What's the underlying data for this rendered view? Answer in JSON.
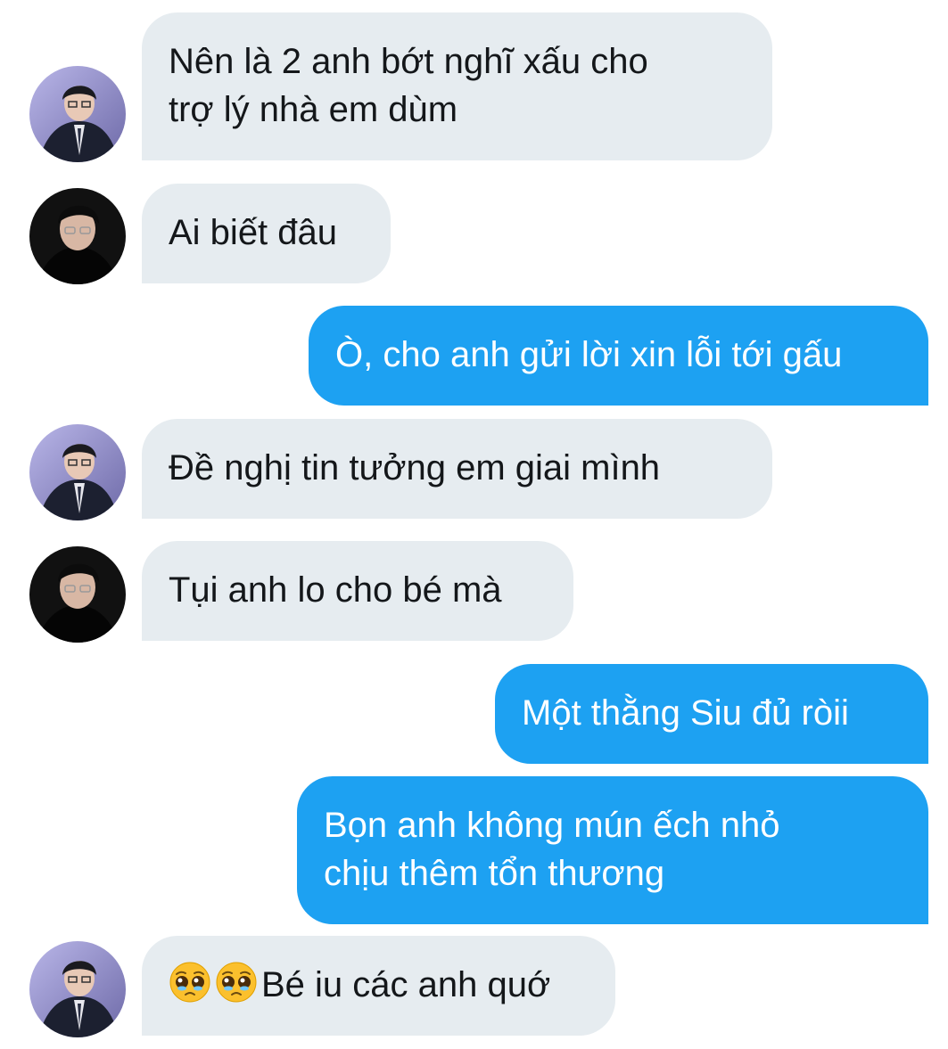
{
  "conversation": {
    "messages": [
      {
        "direction": "in",
        "avatar": "avatar-a",
        "lines": [
          "Nên là 2 anh bớt nghĩ xấu cho",
          "trợ lý nhà em dùm"
        ]
      },
      {
        "direction": "in",
        "avatar": "avatar-b",
        "lines": [
          "Ai biết đâu"
        ]
      },
      {
        "direction": "out",
        "lines": [
          "Ò, cho anh gửi lời xin lỗi tới gấu"
        ]
      },
      {
        "direction": "in",
        "avatar": "avatar-a",
        "lines": [
          "Đề nghị tin tưởng em giai mình"
        ]
      },
      {
        "direction": "in",
        "avatar": "avatar-b",
        "lines": [
          "Tụi anh lo cho bé mà"
        ]
      },
      {
        "direction": "out",
        "lines": [
          "Một thằng Siu đủ ròii"
        ]
      },
      {
        "direction": "out",
        "lines": [
          "Bọn anh không mún ếch nhỏ",
          "chịu thêm tổn thương"
        ]
      },
      {
        "direction": "in",
        "avatar": "avatar-a",
        "emoji": [
          "pleading-face-icon",
          "pleading-face-icon"
        ],
        "lines": [
          "Bé iu các anh quớ"
        ]
      }
    ]
  },
  "colors": {
    "incoming_bubble": "#e6ecf0",
    "outgoing_bubble": "#1da1f2",
    "incoming_text": "#14171a",
    "outgoing_text": "#ffffff"
  }
}
